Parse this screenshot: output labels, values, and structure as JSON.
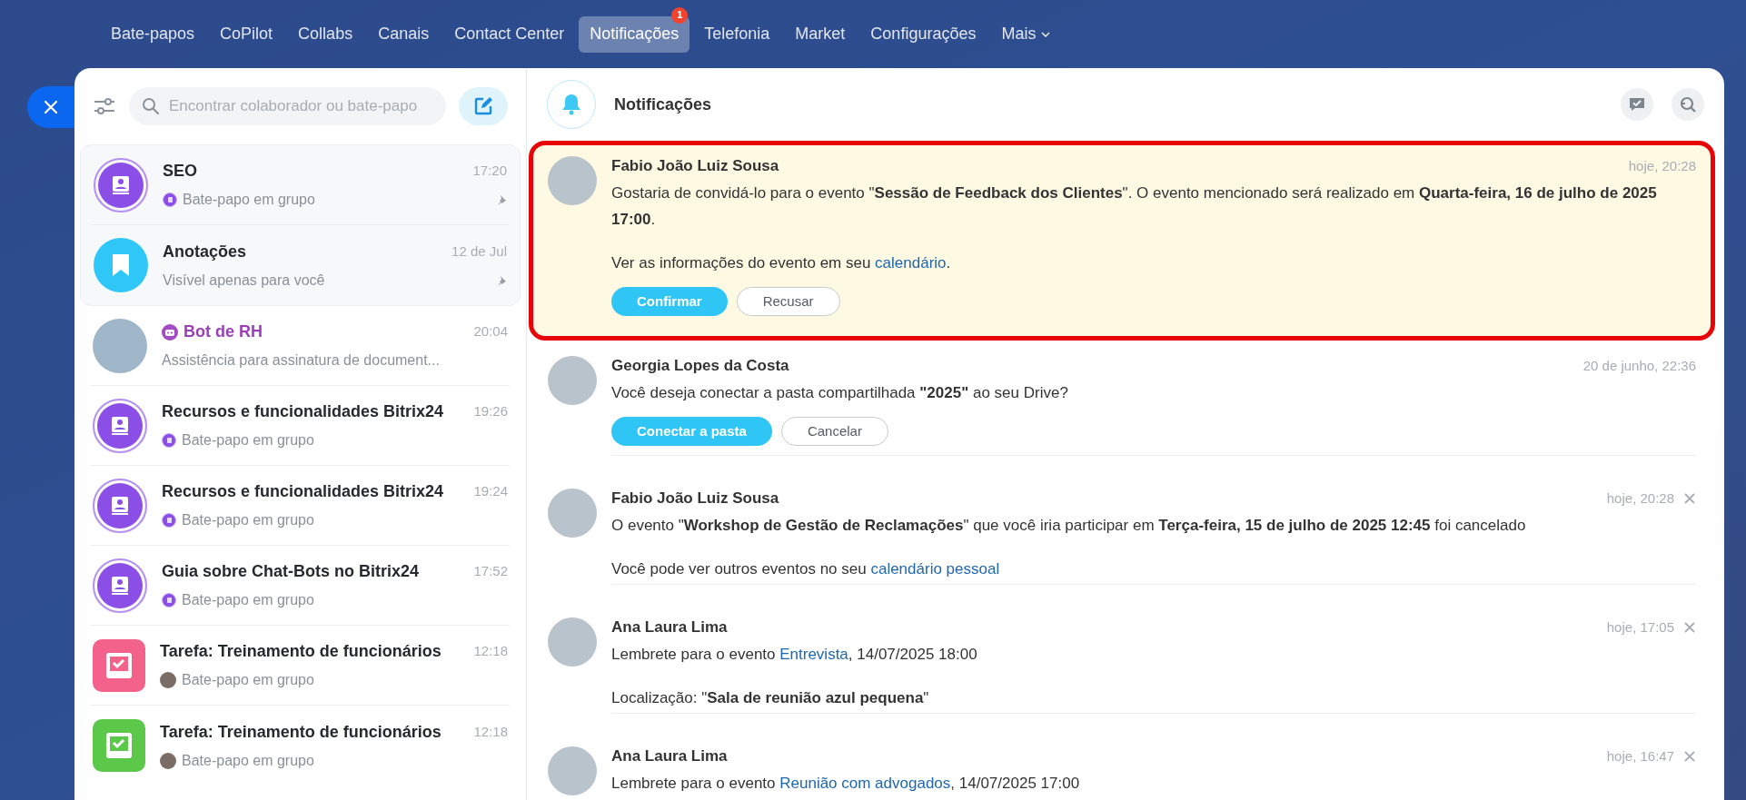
{
  "top_nav": [
    {
      "label": "Bate-papos",
      "selected": false
    },
    {
      "label": "CoPilot",
      "selected": false
    },
    {
      "label": "Collabs",
      "selected": false
    },
    {
      "label": "Canais",
      "selected": false
    },
    {
      "label": "Contact Center",
      "selected": false
    },
    {
      "label": "Notificações",
      "selected": true,
      "badge": "1"
    },
    {
      "label": "Telefonia",
      "selected": false
    },
    {
      "label": "Market",
      "selected": false
    },
    {
      "label": "Configurações",
      "selected": false
    },
    {
      "label": "Mais",
      "selected": false,
      "has_menu": true
    }
  ],
  "search": {
    "placeholder": "Encontrar colaborador ou bate-papo"
  },
  "chats": [
    {
      "kind": "group",
      "title": "SEO",
      "subtitle": {
        "kind": "group",
        "text": "Bate-papo em grupo"
      },
      "time": "17:20",
      "pinned": true,
      "bot": false
    },
    {
      "kind": "notes",
      "title": "Anotações",
      "subtitle": {
        "kind": "plain",
        "text": "Visível apenas para você"
      },
      "time": "12 de Jul",
      "pinned": true,
      "bot": false
    },
    {
      "kind": "photo",
      "title": "Bot de RH",
      "subtitle": {
        "kind": "plain",
        "text": "Assistência para assinatura de document..."
      },
      "time": "20:04",
      "pinned": false,
      "bot": true
    },
    {
      "kind": "group",
      "title": "Recursos e funcionalidades Bitrix24",
      "subtitle": {
        "kind": "group",
        "text": "Bate-papo em grupo"
      },
      "time": "19:26",
      "pinned": false,
      "bot": false
    },
    {
      "kind": "group",
      "title": "Recursos e funcionalidades Bitrix24",
      "subtitle": {
        "kind": "group",
        "text": "Bate-papo em grupo"
      },
      "time": "19:24",
      "pinned": false,
      "bot": false
    },
    {
      "kind": "group",
      "title": "Guia sobre Chat-Bots no Bitrix24",
      "subtitle": {
        "kind": "group",
        "text": "Bate-papo em grupo"
      },
      "time": "17:52",
      "pinned": false,
      "bot": false
    },
    {
      "kind": "task",
      "title": "Tarefa: Treinamento de funcionários",
      "subtitle": {
        "kind": "person",
        "text": "Bate-papo em grupo"
      },
      "time": "12:18",
      "color": "#f2628a",
      "pinned": false,
      "bot": false
    },
    {
      "kind": "task",
      "title": "Tarefa: Treinamento de funcionários",
      "subtitle": {
        "kind": "person",
        "text": "Bate-papo em grupo"
      },
      "time": "12:18",
      "color": "#5bc84a",
      "pinned": false,
      "bot": false
    }
  ],
  "panel": {
    "title": "Notificações"
  },
  "notifications": [
    {
      "author": "Fabio João Luiz Sousa",
      "time": "hoje, 20:28",
      "unread": true,
      "highlighted": true,
      "dismissible": false,
      "paragraphs": [
        [
          {
            "kind": "text",
            "text": "Gostaria de convidá-lo para o evento \"**Sessão de Feedback dos Clientes**\". O evento mencionado será realizado em **Quarta-feira, 16 de julho de 2025 17:00**."
          }
        ],
        [
          {
            "kind": "text",
            "text": "Ver as informações do evento em seu "
          },
          {
            "kind": "link",
            "text": "calendário"
          },
          {
            "kind": "text",
            "text": "."
          }
        ]
      ],
      "buttons": [
        {
          "label": "Confirmar",
          "primary": true
        },
        {
          "label": "Recusar",
          "primary": false
        }
      ]
    },
    {
      "author": "Georgia Lopes da Costa",
      "time": "20 de junho, 22:36",
      "unread": false,
      "highlighted": false,
      "dismissible": false,
      "paragraphs": [
        [
          {
            "kind": "text",
            "text": "Você deseja conectar a pasta compartilhada **\"2025\"** ao seu Drive?"
          }
        ]
      ],
      "buttons": [
        {
          "label": "Conectar a pasta",
          "primary": true
        },
        {
          "label": "Cancelar",
          "primary": false
        }
      ]
    },
    {
      "author": "Fabio João Luiz Sousa",
      "time": "hoje, 20:28",
      "unread": false,
      "highlighted": false,
      "dismissible": true,
      "paragraphs": [
        [
          {
            "kind": "text",
            "text": "O evento \"**Workshop de Gestão de Reclamações**\" que você iria participar em **Terça-feira, 15 de julho de 2025 12:45** foi cancelado"
          }
        ],
        [
          {
            "kind": "text",
            "text": "Você pode ver outros eventos no seu "
          },
          {
            "kind": "link",
            "text": "calendário pessoal"
          }
        ]
      ]
    },
    {
      "author": "Ana Laura Lima",
      "time": "hoje, 17:05",
      "unread": false,
      "highlighted": false,
      "dismissible": true,
      "paragraphs": [
        [
          {
            "kind": "text",
            "text": "Lembrete para o evento "
          },
          {
            "kind": "link",
            "text": "Entrevista"
          },
          {
            "kind": "text",
            "text": ", 14/07/2025 18:00"
          }
        ],
        [
          {
            "kind": "text",
            "text": "Localização: \"**Sala de reunião azul pequena**\""
          }
        ]
      ]
    },
    {
      "author": "Ana Laura Lima",
      "time": "hoje, 16:47",
      "unread": false,
      "highlighted": false,
      "dismissible": true,
      "paragraphs": [
        [
          {
            "kind": "text",
            "text": "Lembrete para o evento "
          },
          {
            "kind": "link",
            "text": "Reunião com advogados"
          },
          {
            "kind": "text",
            "text": ", 14/07/2025 17:00"
          }
        ]
      ]
    }
  ]
}
